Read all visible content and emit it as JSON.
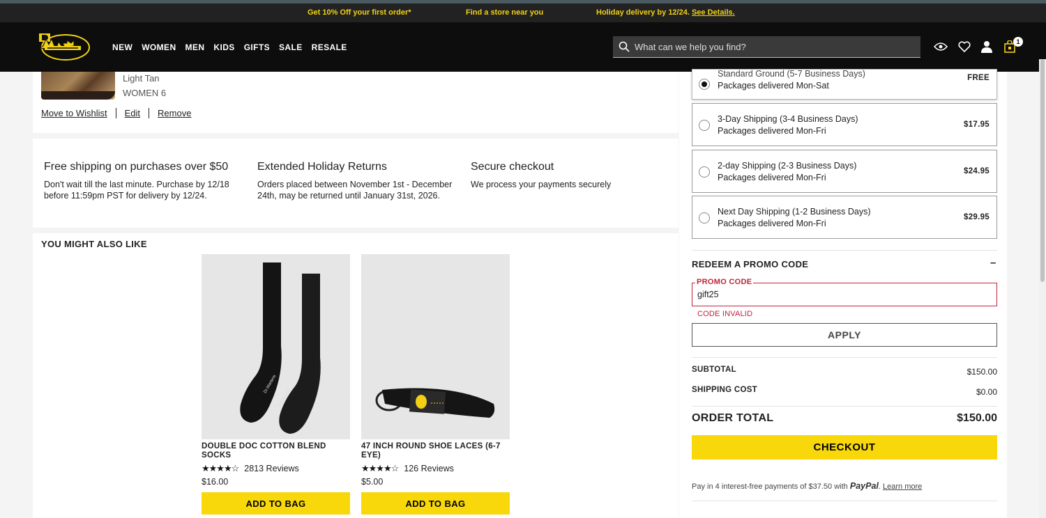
{
  "promo_bar": {
    "offer": "Get 10% Off your first order*",
    "store": "Find a store near you",
    "holiday": "Holiday delivery by 12/24.",
    "details_link": "See Details."
  },
  "header": {
    "nav": [
      "NEW",
      "WOMEN",
      "MEN",
      "KIDS",
      "GIFTS",
      "SALE",
      "RESALE"
    ],
    "search_placeholder": "What can we help you find?",
    "bag_count": "1"
  },
  "cart_item": {
    "color": "Light Tan",
    "size": "WOMEN 6",
    "links": [
      "Move to Wishlist",
      "Edit",
      "Remove"
    ]
  },
  "features": [
    {
      "title": "Free shipping on purchases over $50",
      "text": "Don't wait till the last minute. Purchase by 12/18 before 11:59pm PST for delivery by 12/24."
    },
    {
      "title": "Extended Holiday Returns",
      "text": "Orders placed between November 1st - December 24th, may be returned until January 31st, 2026."
    },
    {
      "title": "Secure checkout",
      "text": "We process your payments securely"
    }
  ],
  "recommendations": {
    "title": "YOU MIGHT ALSO LIKE",
    "products": [
      {
        "name": "DOUBLE DOC COTTON BLEND SOCKS",
        "rating": 4.5,
        "reviews": "2813 Reviews",
        "price": "$16.00",
        "button": "ADD TO BAG"
      },
      {
        "name": "47 INCH ROUND SHOE LACES (6-7 EYE)",
        "rating": 4.5,
        "reviews": "126 Reviews",
        "price": "$5.00",
        "button": "ADD TO BAG"
      }
    ]
  },
  "shipping_options": [
    {
      "name": "Standard Ground (5-7 Business Days)",
      "days": "Packages delivered Mon-Sat",
      "price": "FREE",
      "selected": true
    },
    {
      "name": "3-Day Shipping (3-4 Business Days)",
      "days": "Packages delivered Mon-Fri",
      "price": "$17.95",
      "selected": false
    },
    {
      "name": "2-day Shipping (2-3 Business Days)",
      "days": "Packages delivered Mon-Fri",
      "price": "$24.95",
      "selected": false
    },
    {
      "name": "Next Day Shipping (1-2 Business Days)",
      "days": "Packages delivered Mon-Fri",
      "price": "$29.95",
      "selected": false
    }
  ],
  "promo": {
    "heading": "REDEEM A PROMO CODE",
    "toggle": "–",
    "label": "PROMO CODE",
    "value": "gift25",
    "error": "CODE INVALID",
    "apply": "APPLY"
  },
  "summary": {
    "subtotal_label": "SUBTOTAL",
    "subtotal": "$150.00",
    "shipping_label": "SHIPPING COST",
    "shipping": "$0.00",
    "total_label": "ORDER TOTAL",
    "total": "$150.00",
    "checkout": "CHECKOUT",
    "paypal_text": "Pay in 4 interest-free payments of $37.50 with",
    "paypal_brand": "PayPal",
    "learn_more": "Learn more"
  },
  "colors": {
    "accent": "#f8d80b",
    "error": "#c0223b",
    "header": "#0d0d0d"
  }
}
